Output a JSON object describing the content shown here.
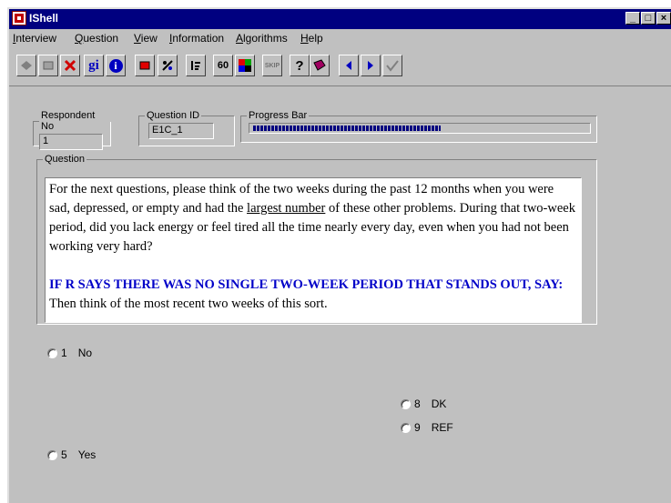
{
  "window": {
    "title": "IShell"
  },
  "caption_buttons": [
    "_",
    "□",
    "×"
  ],
  "menu": [
    {
      "label": "Interview",
      "key": "I"
    },
    {
      "label": "Question",
      "key": "Q"
    },
    {
      "label": "View",
      "key": "V"
    },
    {
      "label": "Information",
      "key": "I"
    },
    {
      "label": "Algorithms",
      "key": "A"
    },
    {
      "label": "Help",
      "key": "H"
    }
  ],
  "toolbar": {
    "gi_label": "gi",
    "info_label": "i",
    "sixty_label": "60",
    "skip_label": "SKIP",
    "help_label": "?"
  },
  "respondent": {
    "label": "Respondent No",
    "value": "1"
  },
  "question_id": {
    "label": "Question ID",
    "value": "E1C_1"
  },
  "progress": {
    "label": "Progress Bar",
    "fraction": 0.56
  },
  "question": {
    "label": "Question",
    "text_before": "For the next questions, please think of the two weeks during the past 12 months when you were sad, depressed, or empty and had the ",
    "underlined": "largest number",
    "text_after": " of these other problems. During that two-week period, did you lack energy or feel tired all the time nearly every day, even when you had not been working very hard?",
    "instruction": "IF R SAYS THERE WAS NO SINGLE TWO-WEEK PERIOD THAT STANDS OUT, SAY:",
    "instruction_followup": " Then think of the most recent two weeks of this sort."
  },
  "options": [
    {
      "code": "1",
      "label": "No"
    },
    {
      "code": "8",
      "label": "DK"
    },
    {
      "code": "9",
      "label": "REF"
    },
    {
      "code": "5",
      "label": "Yes"
    }
  ]
}
